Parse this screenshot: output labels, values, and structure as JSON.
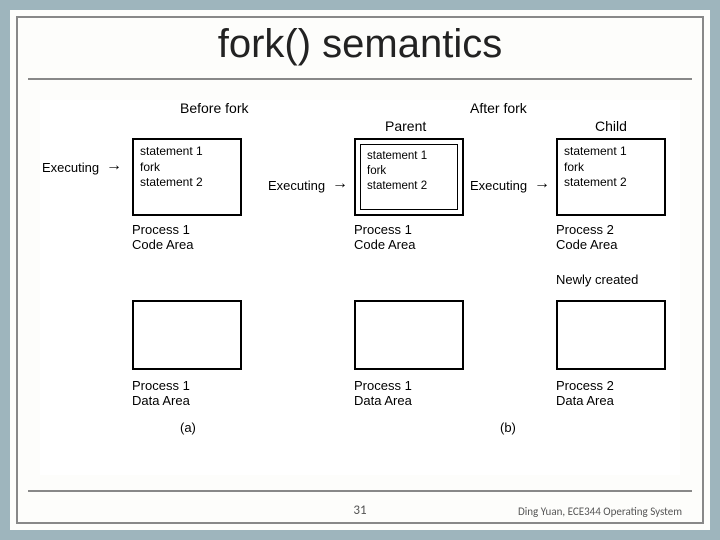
{
  "title": "fork() semantics",
  "headers": {
    "before": "Before fork",
    "after": "After fork"
  },
  "columns": {
    "parent": "Parent",
    "child": "Child"
  },
  "executing": "Executing",
  "arrow": "→",
  "code_lines": "statement 1\nfork\nstatement 2",
  "captions": {
    "p1_code": "Process 1\nCode Area",
    "p1_data": "Process 1\nData Area",
    "p2_code": "Process 2\nCode Area",
    "p2_data": "Process 2\nData Area",
    "newly": "Newly created"
  },
  "subfig": {
    "a": "(a)",
    "b": "(b)"
  },
  "page": "31",
  "credit": "Ding Yuan, ECE344 Operating System"
}
